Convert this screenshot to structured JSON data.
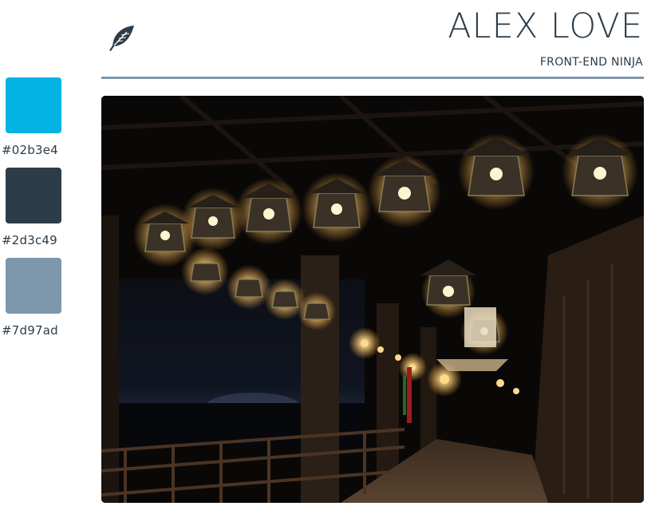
{
  "header": {
    "name": "ALEX LOVE",
    "role": "FRONT-END NINJA",
    "logo_icon": "feather-icon"
  },
  "palette": [
    {
      "hex": "#02b3e4",
      "label": "#02b3e4"
    },
    {
      "hex": "#2d3c49",
      "label": "#2d3c49"
    },
    {
      "hex": "#7d97ad",
      "label": "#7d97ad"
    }
  ],
  "photo": {
    "icon": "hero-photo",
    "subject": ""
  }
}
